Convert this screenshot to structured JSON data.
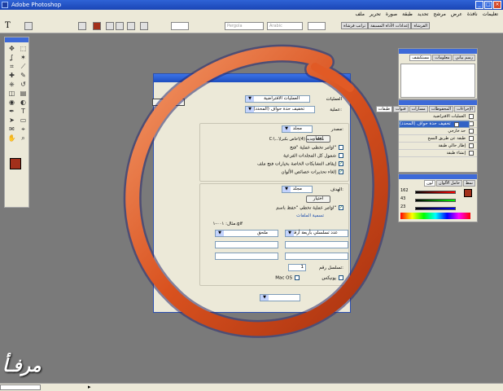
{
  "app": {
    "title": "Adobe Photoshop"
  },
  "menu": [
    "ملف",
    "تحرير",
    "صورة",
    "طبقة",
    "تحديد",
    "مرشح",
    "عرض",
    "نافذة",
    "تعليمات"
  ],
  "options_bar": {
    "tool_glyph": "T",
    "orientation": "Regular",
    "size_label": "Pergola",
    "anti_alias": "Arabic"
  },
  "palette_well": [
    "ترانب فرشاة",
    "إعدادات الأداة المسبقة",
    "الفرشاة"
  ],
  "toolbox": {
    "tools": [
      "move-icon",
      "marquee-icon",
      "lasso-icon",
      "magic-wand-icon",
      "crop-icon",
      "slice-icon",
      "healing-icon",
      "brush-icon",
      "stamp-icon",
      "history-brush-icon",
      "eraser-icon",
      "gradient-icon",
      "blur-icon",
      "dodge-icon",
      "pen-icon",
      "type-icon",
      "path-select-icon",
      "shape-icon",
      "notes-icon",
      "eyedropper-icon",
      "hand-icon",
      "zoom-icon"
    ],
    "foreground": "#a3301b",
    "background": "#ffffff"
  },
  "navigator_panel": {
    "tabs": [
      "مستكشف",
      "معلومات",
      "رسم بياني"
    ]
  },
  "actions_panel": {
    "tabs": [
      "طبقات",
      "قنوات",
      "مسارات",
      "المحفوظات",
      "الإجراءات"
    ],
    "items": [
      "العمليات الافتراضية",
      "تخفيف حدة حواف (المحدد)",
      "إنشاء تسوية قطعة",
      "حد خارجي",
      "طبقة عن طريق النسخ",
      "إطار حالي طبقة",
      "إنشاء طبقة"
    ]
  },
  "color_panel": {
    "tabs": [
      "لون",
      "حامل الألوان",
      "نمط"
    ],
    "r": "162",
    "g": "43",
    "b": "23"
  },
  "dialog": {
    "title": "",
    "ok_label": "",
    "set_label": "العمليات",
    "set_value": "العمليات الافتراضية",
    "action_label": "عملية:",
    "action_value": "تخفيف حدة حواف (المحدد)",
    "source_label": "مصدر:",
    "source_value": "مجلد",
    "choose_label": "اختيار",
    "source_path": "C:\\...\\مجلد جديد (4)\\خاص بكبرا",
    "checks": [
      {
        "label": "اوامر تخطي عملية \"فتح\"",
        "checked": false
      },
      {
        "label": "شمول كل المجلدات الفرعية",
        "checked": false
      },
      {
        "label": "إيقاف التشابكات الخاصة بخيارات فتح ملف",
        "checked": true
      },
      {
        "label": "إلغاء تحذيرات خصائص الألوان",
        "checked": true
      }
    ],
    "dest_label": "الهدف:",
    "dest_value": "مجلد",
    "choose2_label": "اختيار",
    "override_save": "اوامر عملية تخطي \"حفظ باسم\"",
    "naming_label": "تسمية الملفات",
    "example": "مثال: ٠٠١-١.gif",
    "name_field1": "عدد تسلسلي بأربعة أرقام",
    "name_field2": "ملحق",
    "serial_label": "تسلسل رقم:",
    "serial_value": "1",
    "compat_label": "توافق:",
    "mac": "Mac OS",
    "unix": "يونيكس"
  },
  "watermark": "مرفـأ"
}
